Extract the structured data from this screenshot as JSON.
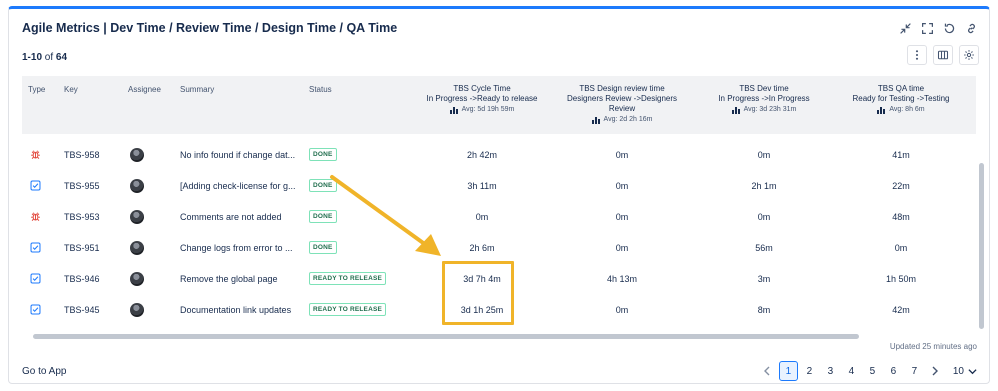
{
  "header": {
    "title": "Agile Metrics | Dev Time / Review Time / Design Time / QA Time",
    "icons": [
      "collapse-icon",
      "fullscreen-icon",
      "refresh-icon",
      "link-icon"
    ]
  },
  "summary": {
    "range": "1-10",
    "of_label": "of",
    "total": "64"
  },
  "toolbar": {
    "icons": [
      "more-vertical-icon",
      "columns-icon",
      "settings-icon"
    ]
  },
  "columns": {
    "type": "Type",
    "key": "Key",
    "assignee": "Assignee",
    "summary": "Summary",
    "status": "Status",
    "cycle": {
      "name": "TBS Cycle Time",
      "transition": "In Progress ->Ready to release",
      "avg": "Avg: 5d 19h 59m"
    },
    "design": {
      "name": "TBS Design review time",
      "transition": "Designers Review ->Designers Review",
      "avg": "Avg: 2d 2h 16m"
    },
    "dev": {
      "name": "TBS Dev time",
      "transition": "In Progress ->In Progress",
      "avg": "Avg: 3d 23h 31m"
    },
    "qa": {
      "name": "TBS QA time",
      "transition": "Ready for Testing ->Testing",
      "avg": "Avg: 8h 6m"
    }
  },
  "rows": [
    {
      "type": "bug",
      "key": "TBS-958",
      "summary": "No info found if change dat...",
      "status": "DONE",
      "cycle": "2h 42m",
      "design": "0m",
      "dev": "0m",
      "qa": "41m"
    },
    {
      "type": "task",
      "key": "TBS-955",
      "summary": "[Adding check-license for g...",
      "status": "DONE",
      "cycle": "3h 11m",
      "design": "0m",
      "dev": "2h 1m",
      "qa": "22m"
    },
    {
      "type": "bug",
      "key": "TBS-953",
      "summary": "Comments are not added",
      "status": "DONE",
      "cycle": "0m",
      "design": "0m",
      "dev": "0m",
      "qa": "48m"
    },
    {
      "type": "task",
      "key": "TBS-951",
      "summary": "Change logs from error to ...",
      "status": "DONE",
      "cycle": "2h 6m",
      "design": "0m",
      "dev": "56m",
      "qa": "0m"
    },
    {
      "type": "task",
      "key": "TBS-946",
      "summary": "Remove the global page",
      "status": "READY TO RELEASE",
      "cycle": "3d 7h 4m",
      "design": "4h 13m",
      "dev": "3m",
      "qa": "1h 50m"
    },
    {
      "type": "task",
      "key": "TBS-945",
      "summary": "Documentation link updates",
      "status": "READY TO RELEASE",
      "cycle": "3d 1h 25m",
      "design": "0m",
      "dev": "8m",
      "qa": "42m"
    }
  ],
  "footer": {
    "updated": "Updated 25 minutes ago",
    "goto": "Go to App",
    "pages": [
      "1",
      "2",
      "3",
      "4",
      "5",
      "6",
      "7"
    ],
    "current_page": "1",
    "per_page": "10"
  },
  "colors": {
    "accent": "#1d7afc",
    "bug": "#e2483d",
    "task": "#1d7afc",
    "highlight": "#f0b429",
    "done_badge": "#216e4e"
  }
}
